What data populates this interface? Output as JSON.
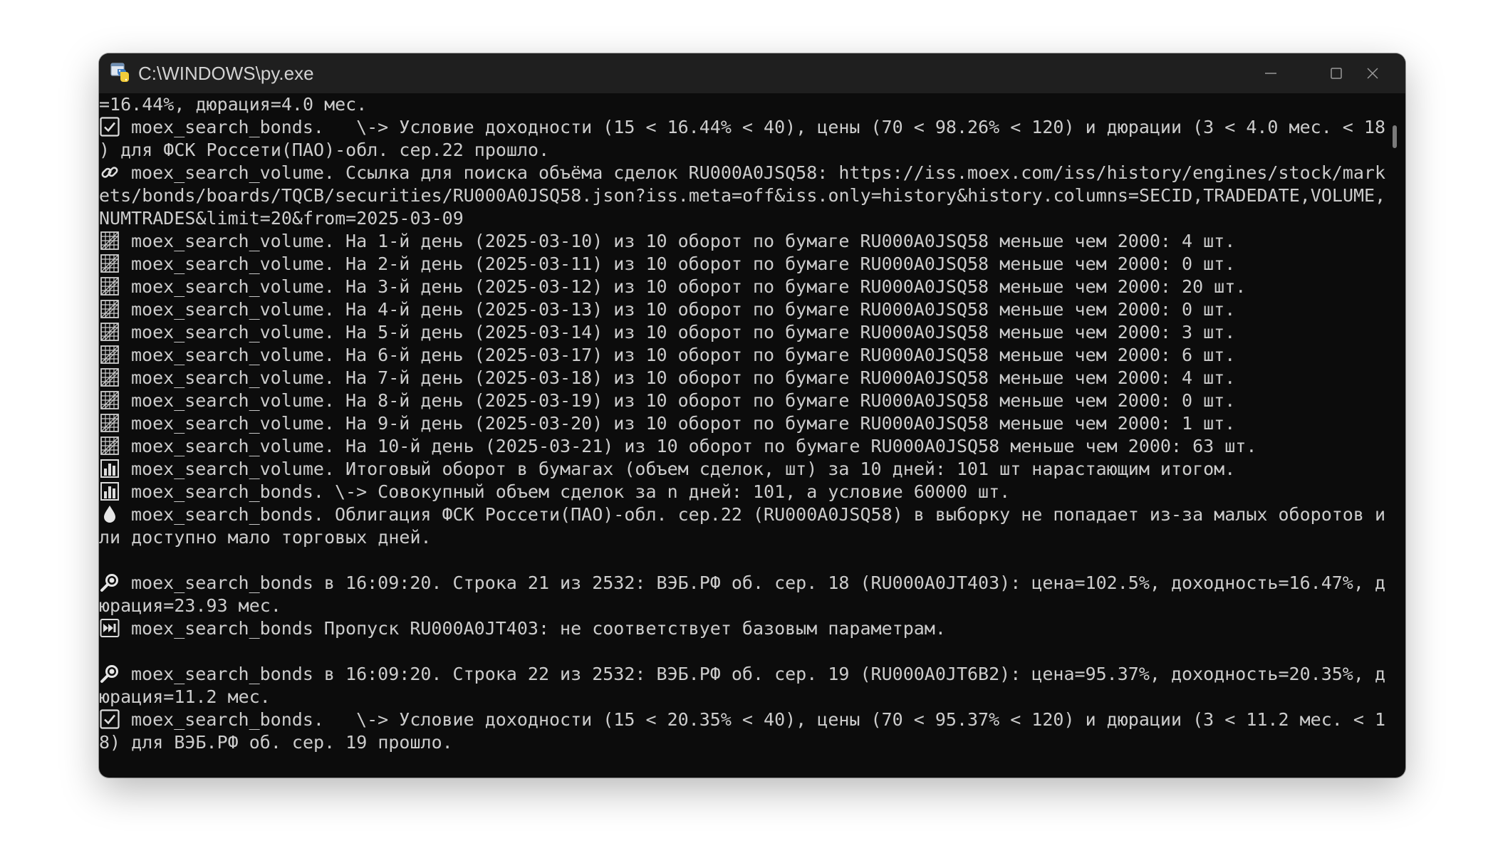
{
  "window": {
    "title": "C:\\WINDOWS\\py.exe"
  },
  "console": {
    "lines": [
      {
        "icon": "",
        "text": "=16.44%, дюрация=4.0 мес."
      },
      {
        "icon": "check-box-icon",
        "text": "moex_search_bonds.   \\-> Условие доходности (15 < 16.44% < 40), цены (70 < 98.26% < 120) и дюрации (3 < 4.0 мес. < 18"
      },
      {
        "icon": "",
        "text": ") для ФСК Россети(ПАО)-обл. сер.22 прошло."
      },
      {
        "icon": "link-icon",
        "text": "moex_search_volume. Ссылка для поиска объёма сделок RU000A0JSQ58: https://iss.moex.com/iss/history/engines/stock/mark"
      },
      {
        "icon": "",
        "text": "ets/bonds/boards/TQCB/securities/RU000A0JSQ58.json?iss.meta=off&iss.only=history&history.columns=SECID,TRADEDATE,VOLUME,"
      },
      {
        "icon": "",
        "text": "NUMTRADES&limit=20&from=2025-03-09"
      },
      {
        "icon": "calendar-icon",
        "text": "moex_search_volume. На 1-й день (2025-03-10) из 10 оборот по бумаге RU000A0JSQ58 меньше чем 2000: 4 шт."
      },
      {
        "icon": "calendar-icon",
        "text": "moex_search_volume. На 2-й день (2025-03-11) из 10 оборот по бумаге RU000A0JSQ58 меньше чем 2000: 0 шт."
      },
      {
        "icon": "calendar-icon",
        "text": "moex_search_volume. На 3-й день (2025-03-12) из 10 оборот по бумаге RU000A0JSQ58 меньше чем 2000: 20 шт."
      },
      {
        "icon": "calendar-icon",
        "text": "moex_search_volume. На 4-й день (2025-03-13) из 10 оборот по бумаге RU000A0JSQ58 меньше чем 2000: 0 шт."
      },
      {
        "icon": "calendar-icon",
        "text": "moex_search_volume. На 5-й день (2025-03-14) из 10 оборот по бумаге RU000A0JSQ58 меньше чем 2000: 3 шт."
      },
      {
        "icon": "calendar-icon",
        "text": "moex_search_volume. На 6-й день (2025-03-17) из 10 оборот по бумаге RU000A0JSQ58 меньше чем 2000: 6 шт."
      },
      {
        "icon": "calendar-icon",
        "text": "moex_search_volume. На 7-й день (2025-03-18) из 10 оборот по бумаге RU000A0JSQ58 меньше чем 2000: 4 шт."
      },
      {
        "icon": "calendar-icon",
        "text": "moex_search_volume. На 8-й день (2025-03-19) из 10 оборот по бумаге RU000A0JSQ58 меньше чем 2000: 0 шт."
      },
      {
        "icon": "calendar-icon",
        "text": "moex_search_volume. На 9-й день (2025-03-20) из 10 оборот по бумаге RU000A0JSQ58 меньше чем 2000: 1 шт."
      },
      {
        "icon": "calendar-icon",
        "text": "moex_search_volume. На 10-й день (2025-03-21) из 10 оборот по бумаге RU000A0JSQ58 меньше чем 2000: 63 шт."
      },
      {
        "icon": "bar-chart-icon",
        "text": "moex_search_volume. Итоговый оборот в бумагах (объем сделок, шт) за 10 дней: 101 шт нарастающим итогом."
      },
      {
        "icon": "bar-chart-icon",
        "text": "moex_search_bonds. \\-> Совокупный объем сделок за n дней: 101, а условие 60000 шт."
      },
      {
        "icon": "droplet-icon",
        "text": "moex_search_bonds. Облигация ФСК Россети(ПАО)-обл. сер.22 (RU000A0JSQ58) в выборку не попадает из-за малых оборотов и"
      },
      {
        "icon": "",
        "text": "ли доступно мало торговых дней."
      },
      {
        "icon": "",
        "text": ""
      },
      {
        "icon": "magnifier-icon",
        "text": "moex_search_bonds в 16:09:20. Строка 21 из 2532: ВЭБ.РФ об. сер. 18 (RU000A0JT403): цена=102.5%, доходность=16.47%, д"
      },
      {
        "icon": "",
        "text": "юрация=23.93 мес."
      },
      {
        "icon": "skip-icon",
        "text": "moex_search_bonds Пропуск RU000A0JT403: не соответствует базовым параметрам."
      },
      {
        "icon": "",
        "text": ""
      },
      {
        "icon": "magnifier-icon",
        "text": "moex_search_bonds в 16:09:20. Строка 22 из 2532: ВЭБ.РФ об. сер. 19 (RU000A0JT6B2): цена=95.37%, доходность=20.35%, д"
      },
      {
        "icon": "",
        "text": "юрация=11.2 мес."
      },
      {
        "icon": "check-box-icon",
        "text": "moex_search_bonds.   \\-> Условие доходности (15 < 20.35% < 40), цены (70 < 95.37% < 120) и дюрации (3 < 11.2 мес. < 1"
      },
      {
        "icon": "",
        "text": "8) для ВЭБ.РФ об. сер. 19 прошло."
      }
    ]
  }
}
